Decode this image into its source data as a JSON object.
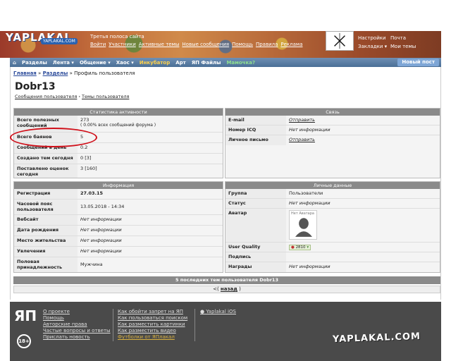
{
  "header": {
    "logo": "YAPLAKAL",
    "logo_sub": "YAPLAKAL.COM",
    "tagline": "Третья полоса сайта",
    "links": [
      "Войти",
      "Участники",
      "Активные темы",
      "Новые сообщения",
      "Помощь",
      "Правила",
      "Реклама"
    ],
    "right_top": [
      "Настройки",
      "Почта"
    ],
    "right_bottom": [
      "Закладки ▾",
      "Мои темы"
    ]
  },
  "navbar": {
    "items": [
      "⌂",
      "Разделы",
      "Лента ▾",
      "Общение ▾",
      "Хаос ▾",
      "Инкубатор",
      "Арт",
      "ЯП Файлы",
      "Мамочка?"
    ],
    "new_post": "Новый пост"
  },
  "breadcrumb": {
    "home": "Главная",
    "sep1": "»",
    "sections": "Разделы",
    "sep2": "»",
    "current": "Профиль пользователя"
  },
  "profile": {
    "username": "Dobr13",
    "sub_link1": "Сообщения пользователя",
    "sub_sep": "·",
    "sub_link2": "Темы пользователя"
  },
  "activity": {
    "header": "Статистика активности",
    "rows": [
      {
        "k": "Всего полезных сообщений",
        "v": "273",
        "v2": "( 0.00% всех сообщений форума )"
      },
      {
        "k": "Всего баянов",
        "v": "5"
      },
      {
        "k": "Сообщений в день",
        "v": "0.2"
      },
      {
        "k": "Создано тем сегодня",
        "v": "0 [3]"
      },
      {
        "k": "Поставлено оценок сегодня",
        "v": "3 [160]"
      }
    ]
  },
  "contact": {
    "header": "Связь",
    "rows": [
      {
        "k": "E-mail",
        "v": "Отправить"
      },
      {
        "k": "Номер ICQ",
        "v": "Нет информации"
      },
      {
        "k": "Личное письмо",
        "v": "Отправить"
      }
    ]
  },
  "info": {
    "header": "Информация",
    "rows": [
      {
        "k": "Регистрация",
        "v": "27.03.15"
      },
      {
        "k": "Часовой пояс пользователя",
        "v": "13.05.2018 - 14:34"
      },
      {
        "k": "Вебсайт",
        "v": "Нет информации"
      },
      {
        "k": "Дата рождения",
        "v": "Нет информации"
      },
      {
        "k": "Место жительства",
        "v": "Нет информации"
      },
      {
        "k": "Увлечения",
        "v": "Нет информации"
      },
      {
        "k": "Половая принадлежность",
        "v": "Мужчина"
      }
    ]
  },
  "personal": {
    "header": "Личные данные",
    "rows": [
      {
        "k": "Группа",
        "v": "Пользователи"
      },
      {
        "k": "Статус",
        "v": "Нет информации"
      },
      {
        "k": "Аватар",
        "v": "Нет Аватара"
      },
      {
        "k": "User Quality",
        "v": "2810"
      },
      {
        "k": "Подпись",
        "v": ""
      },
      {
        "k": "Награды",
        "v": "Нет информации"
      }
    ]
  },
  "last_topics": "5 последних тем пользователя Dobr13",
  "nav_back": {
    "prefix": "<(",
    "link": "назад",
    "suffix": ")"
  },
  "footer": {
    "logo": "ЯП",
    "age": "18+",
    "col1": [
      "О проекте",
      "Помощь",
      "Авторские права",
      "Частые вопросы и ответы",
      "Прислать новость"
    ],
    "col2": [
      "Как обойти запрет на ЯП",
      "Как пользоваться поиском",
      "Как разместить картинки",
      "Как разместить видео",
      "Футболки от ЯПлакал"
    ],
    "col3": [
      "Yaplakal iOS"
    ],
    "brand": "YAPLAKAL.COM"
  }
}
